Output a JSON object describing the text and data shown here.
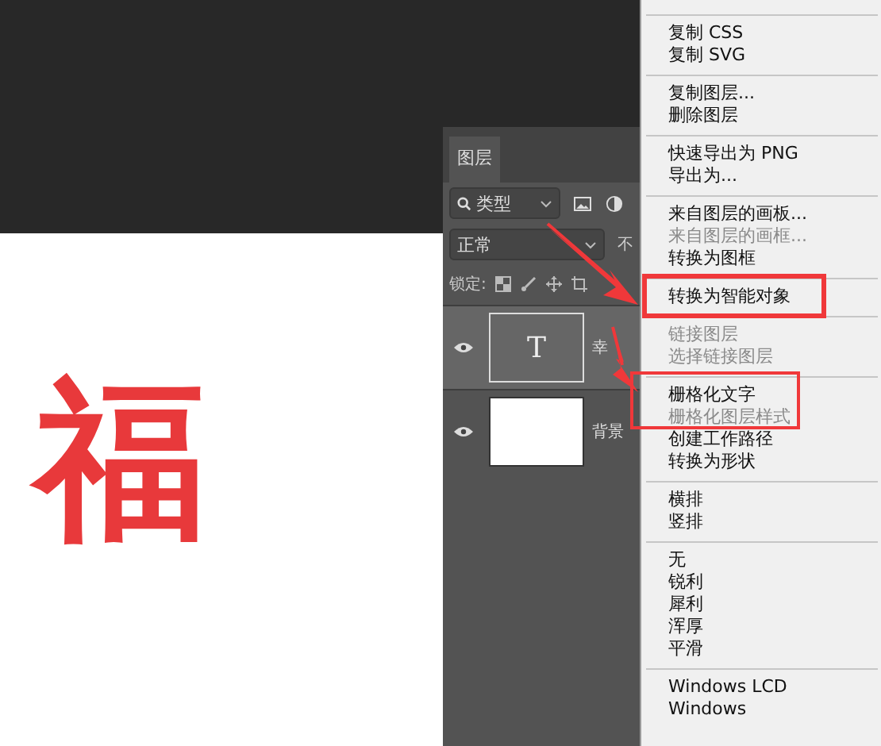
{
  "canvas": {
    "glyph": "福"
  },
  "layers_panel": {
    "tab": "图层",
    "filter": "类型",
    "blend_mode": "正常",
    "opacity_label": "不",
    "lock_label": "锁定:",
    "layers": [
      {
        "name": "幸",
        "kind": "text",
        "thumb": "T",
        "visible": true,
        "selected": true
      },
      {
        "name": "背景",
        "kind": "fill",
        "visible": true,
        "selected": false
      }
    ]
  },
  "context_menu": {
    "groups": [
      [
        {
          "label": "复制 CSS",
          "disabled": false
        },
        {
          "label": "复制 SVG",
          "disabled": false
        }
      ],
      [
        {
          "label": "复制图层...",
          "disabled": false
        },
        {
          "label": "删除图层",
          "disabled": false
        }
      ],
      [
        {
          "label": "快速导出为 PNG",
          "disabled": false
        },
        {
          "label": "导出为...",
          "disabled": false
        }
      ],
      [
        {
          "label": "来自图层的画板...",
          "disabled": false
        },
        {
          "label": "来自图层的画框...",
          "disabled": true
        },
        {
          "label": "转换为图框",
          "disabled": false
        }
      ],
      [
        {
          "label": "转换为智能对象",
          "disabled": false
        }
      ],
      [
        {
          "label": "链接图层",
          "disabled": true
        },
        {
          "label": "选择链接图层",
          "disabled": true
        }
      ],
      [
        {
          "label": "栅格化文字",
          "disabled": false
        },
        {
          "label": "栅格化图层样式",
          "disabled": true
        },
        {
          "label": "创建工作路径",
          "disabled": false
        },
        {
          "label": "转换为形状",
          "disabled": false
        }
      ],
      [
        {
          "label": "横排",
          "disabled": false
        },
        {
          "label": "竖排",
          "disabled": false
        }
      ],
      [
        {
          "label": "无",
          "disabled": false
        },
        {
          "label": "锐利",
          "disabled": false
        },
        {
          "label": "犀利",
          "disabled": false
        },
        {
          "label": "浑厚",
          "disabled": false
        },
        {
          "label": "平滑",
          "disabled": false
        }
      ],
      [
        {
          "label": "Windows LCD",
          "disabled": false
        },
        {
          "label": "Windows",
          "disabled": false
        }
      ]
    ]
  }
}
